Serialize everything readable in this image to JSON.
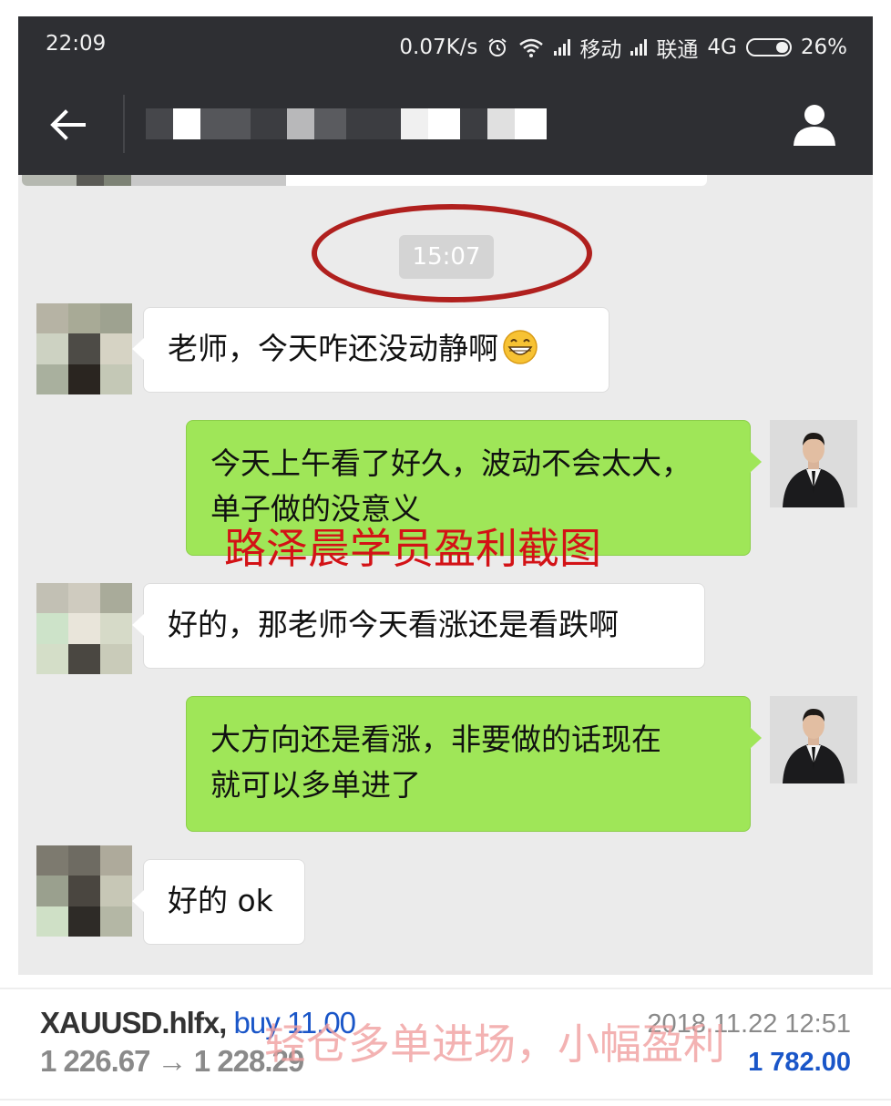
{
  "status_bar": {
    "time": "22:09",
    "speed": "0.07K/s",
    "carrier1": "移动",
    "carrier2": "联通",
    "network": "4G",
    "battery": "26%"
  },
  "header": {
    "back_icon": "arrow-left-icon",
    "profile_icon": "person-icon"
  },
  "chat": {
    "timestamp": "15:07",
    "messages": [
      {
        "side": "in",
        "text": "老师，今天咋还没动静啊",
        "emoji": "grinning-face-icon"
      },
      {
        "side": "out",
        "line1": "今天上午看了好久，波动不会太大，",
        "line2": "单子做的没意义"
      },
      {
        "side": "in",
        "text": "好的，那老师今天看涨还是看跌啊"
      },
      {
        "side": "out",
        "line1": "大方向还是看涨，非要做的话现在",
        "line2": "就可以多单进了"
      },
      {
        "side": "in",
        "text": "好的 ok"
      }
    ]
  },
  "watermark_red": "路泽晨学员盈利截图",
  "trade": {
    "symbol": "XAUUSD.hlfx,",
    "action": "buy 11.00",
    "datetime": "2018.11.22 12:51",
    "prices": "1 226.67 → 1 228.29",
    "profit": "1 782.00",
    "overlay_note": "轻仓多单进场，小幅盈利"
  },
  "colors": {
    "header_bg": "#2e2f33",
    "chat_bg": "#ebebeb",
    "bubble_out": "#9fe658",
    "bubble_in": "#ffffff",
    "circle": "#b0201e",
    "watermark_red": "#d31216",
    "trade_blue": "#1a56c8"
  }
}
